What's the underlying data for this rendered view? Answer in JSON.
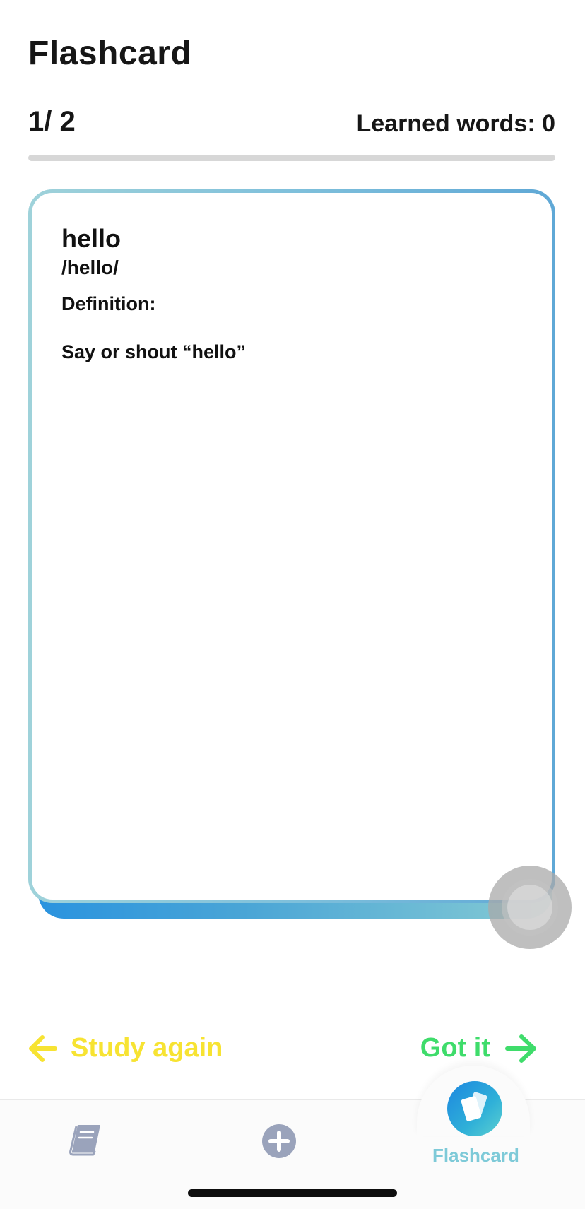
{
  "header": {
    "title": "Flashcard",
    "counter": "1/ 2",
    "learned": "Learned words: 0"
  },
  "progress": {
    "fraction": 0
  },
  "card": {
    "word": "hello",
    "phonetic": "/hello/",
    "definition_label": "Definition:",
    "definition_text": "Say or shout “hello”"
  },
  "actions": {
    "study_again": "Study again",
    "got_it": "Got it"
  },
  "tabbar": {
    "items": [
      {
        "icon": "book-icon",
        "label": ""
      },
      {
        "icon": "plus-circle-icon",
        "label": ""
      },
      {
        "icon": "flashcard-icon",
        "label": "Flashcard",
        "active": true
      }
    ]
  },
  "colors": {
    "study_again": "#f7e332",
    "got_it": "#3fdc6b",
    "accent": "#2fb0d8",
    "tab_inactive": "#9aa3bb"
  }
}
